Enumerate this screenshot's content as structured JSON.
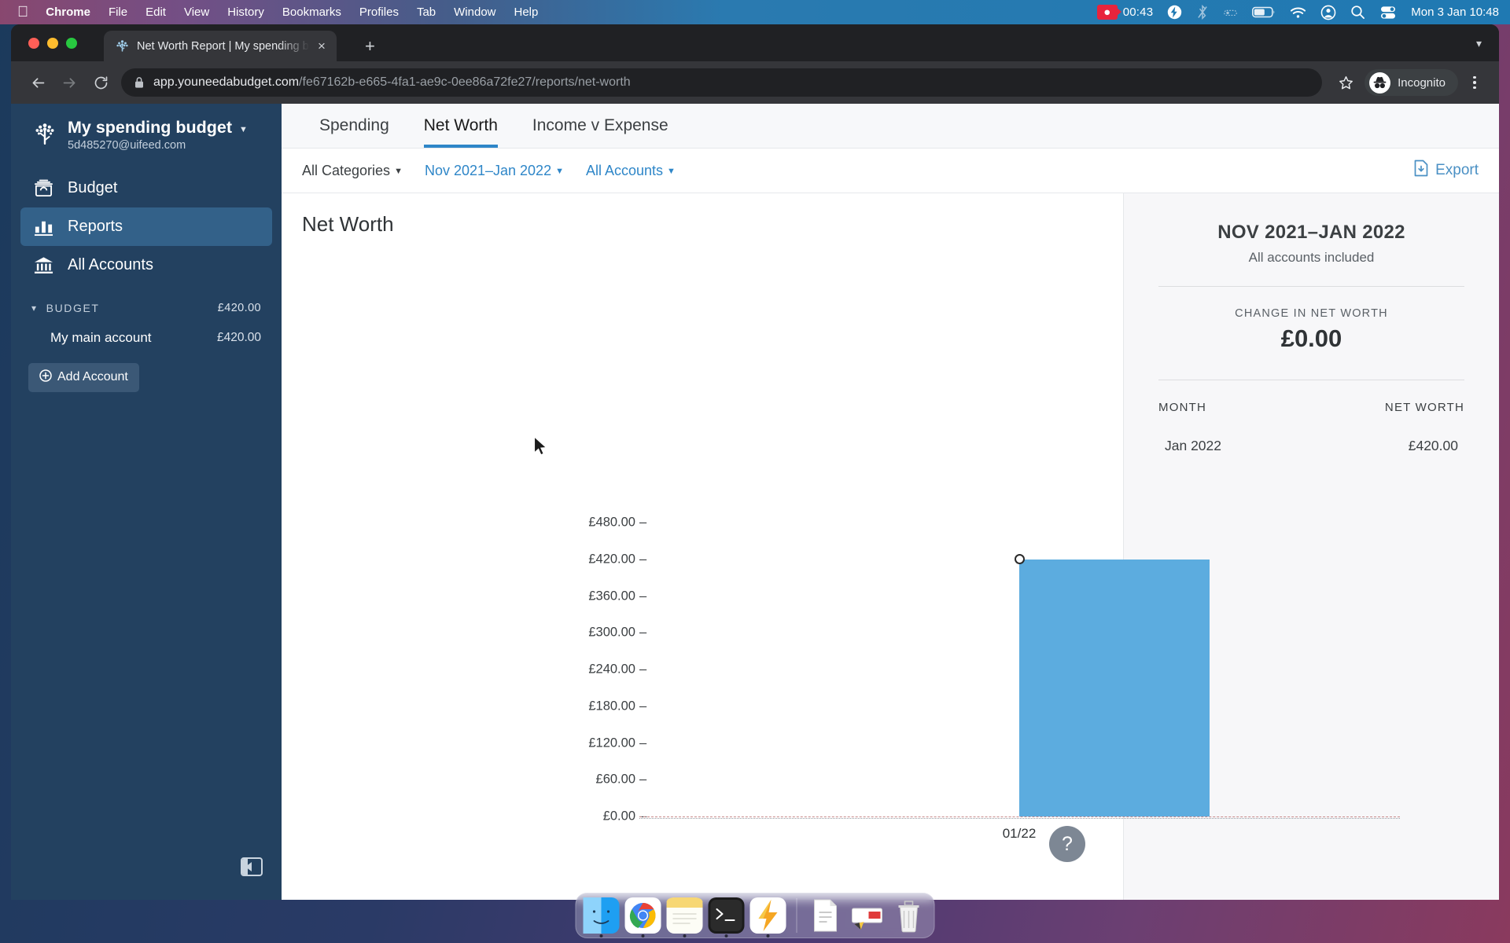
{
  "menubar": {
    "apple_icon": "apple-logo-icon",
    "items": [
      "Chrome",
      "File",
      "Edit",
      "View",
      "History",
      "Bookmarks",
      "Profiles",
      "Tab",
      "Window",
      "Help"
    ],
    "recording_time": "00:43",
    "status_icons": [
      "screen-recording-icon",
      "bolt-icon",
      "bluetooth-off-icon",
      "control-center-icon",
      "battery-icon",
      "wifi-icon",
      "account-icon",
      "search-icon",
      "control-center-toggles-icon"
    ],
    "clock": "Mon 3 Jan  10:48"
  },
  "browser": {
    "tab_title": "Net Worth Report | My spending budget",
    "tab_favicon": "ynab-tree-icon",
    "close_tab_label": "×",
    "new_tab_label": "+",
    "tab_list_chevron": "chevron-down-icon",
    "url_domain": "app.youneedabudget.com",
    "url_path": "/fe67162b-e665-4fa1-ae9c-0ee86a72fe27/reports/net-worth",
    "profile_label": "Incognito",
    "back_icon": "back-arrow-icon",
    "forward_icon": "forward-arrow-icon",
    "reload_icon": "reload-icon",
    "lock_icon": "lock-icon",
    "bookmark_icon": "star-icon",
    "menu_icon": "kebab-menu-icon"
  },
  "sidebar": {
    "budget_name": "My spending budget",
    "account_email": "5d485270@uifeed.com",
    "caret_icon": "caret-down-icon",
    "nav": [
      {
        "label": "Budget",
        "icon": "budget-icon",
        "active": false
      },
      {
        "label": "Reports",
        "icon": "reports-bar-chart-icon",
        "active": true
      },
      {
        "label": "All Accounts",
        "icon": "bank-icon",
        "active": false
      }
    ],
    "section_label": "BUDGET",
    "section_amount": "£420.00",
    "section_chevron": "chevron-down-icon",
    "accounts": [
      {
        "name": "My main account",
        "amount": "£420.00"
      }
    ],
    "add_account_label": "Add Account",
    "add_account_icon": "plus-circle-icon",
    "collapse_icon": "collapse-sidebar-icon"
  },
  "report": {
    "tabs": [
      {
        "label": "Spending",
        "active": false
      },
      {
        "label": "Net Worth",
        "active": true
      },
      {
        "label": "Income v Expense",
        "active": false
      }
    ],
    "filters": [
      {
        "label": "All Categories",
        "style": "dark"
      },
      {
        "label": "Nov 2021–Jan 2022",
        "style": "link"
      },
      {
        "label": "All Accounts",
        "style": "link"
      }
    ],
    "filter_caret": "caret-down-icon",
    "export_label": "Export",
    "export_icon": "export-file-icon",
    "chart_title": "Net Worth",
    "help_label": "?",
    "help_icon": "help-question-icon"
  },
  "chart_data": {
    "type": "bar",
    "title": "Net Worth",
    "categories": [
      "01/22"
    ],
    "values": [
      420
    ],
    "series": [
      {
        "name": "Net Worth",
        "values": [
          420
        ]
      }
    ],
    "xlabel": "",
    "ylabel": "",
    "ylim": [
      0,
      480
    ],
    "yticks": [
      0,
      60,
      120,
      180,
      240,
      300,
      360,
      420,
      480
    ],
    "ytick_labels": [
      "£0.00",
      "£60.00",
      "£120.00",
      "£180.00",
      "£240.00",
      "£300.00",
      "£360.00",
      "£420.00",
      "£480.00"
    ],
    "bar_color": "#5cacdf",
    "grid": false,
    "legend": "none",
    "markers": [
      {
        "x": "01/22",
        "y": 420,
        "style": "open-circle"
      }
    ]
  },
  "summary": {
    "period_title": "NOV 2021–JAN 2022",
    "period_subtitle": "All accounts included",
    "change_label": "CHANGE IN NET WORTH",
    "change_value": "£0.00",
    "table_headers": {
      "month": "MONTH",
      "net_worth": "NET WORTH"
    },
    "rows": [
      {
        "month": "Jan 2022",
        "net_worth": "£420.00"
      }
    ]
  },
  "dock": {
    "items": [
      "finder-icon",
      "chrome-icon",
      "notes-icon",
      "terminal-icon",
      "bolt-app-icon",
      "document-icon",
      "mail-icon",
      "trash-icon"
    ]
  },
  "colors": {
    "accent_blue": "#2e86c8",
    "bar_blue": "#5cacdf",
    "sidebar_navy": "#234160",
    "sidebar_active": "#336189"
  }
}
